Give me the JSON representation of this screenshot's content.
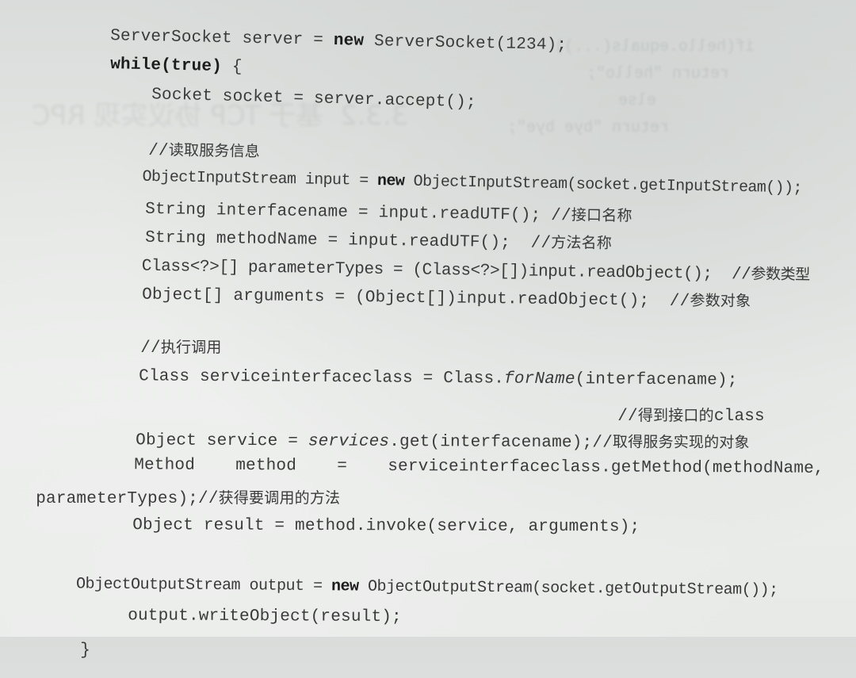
{
  "document": {
    "type": "printed code listing (photo of book page)",
    "lines": [
      {
        "id": "l1",
        "parts": [
          "ServerSocket server = ",
          "new",
          " ServerSocket(1234);"
        ]
      },
      {
        "id": "l2",
        "parts": [
          "while(true)",
          " {"
        ]
      },
      {
        "id": "l3",
        "text": "Socket socket = server.accept();"
      },
      {
        "id": "l4",
        "code": "//",
        "comment": "读取服务信息"
      },
      {
        "id": "l5",
        "parts": [
          "ObjectInputStream input = ",
          "new",
          " ObjectInputStream(socket.getInputStream());"
        ]
      },
      {
        "id": "l6",
        "code": "String interfacename = input.readUTF(); //",
        "comment": "接口名称"
      },
      {
        "id": "l7",
        "code": "String methodName = input.readUTF();  //",
        "comment": "方法名称"
      },
      {
        "id": "l8",
        "code": "Class<?>[] parameterTypes = (Class<?>[])input.readObject();  //",
        "comment": "参数类型"
      },
      {
        "id": "l9",
        "code": "Object[] arguments = (Object[])input.readObject();  //",
        "comment": "参数对象"
      },
      {
        "id": "l10",
        "code": "//",
        "comment": "执行调用"
      },
      {
        "id": "l11",
        "parts": [
          "Class serviceinterfaceclass = Class.",
          "forName",
          "(interfacename);"
        ]
      },
      {
        "id": "l12",
        "code": "//",
        "comment": "得到接口的",
        "tail": "class"
      },
      {
        "id": "l13",
        "parts": [
          "Object service = ",
          "services",
          ".get(interfacename);//"
        ],
        "comment": "取得服务实现的对象"
      },
      {
        "id": "l14",
        "text": "Method    method    =    serviceinterfaceclass.getMethod(methodName,"
      },
      {
        "id": "l15",
        "code": "parameterTypes);//",
        "comment": "获得要调用的方法"
      },
      {
        "id": "l16",
        "text": "Object result = method.invoke(service, arguments);"
      },
      {
        "id": "l17",
        "parts": [
          "ObjectOutputStream output = ",
          "new",
          " ObjectOutputStream(socket.getOutputStream());"
        ]
      },
      {
        "id": "l18",
        "text": "output.writeObject(result);"
      },
      {
        "id": "l19",
        "text": "}"
      }
    ]
  }
}
